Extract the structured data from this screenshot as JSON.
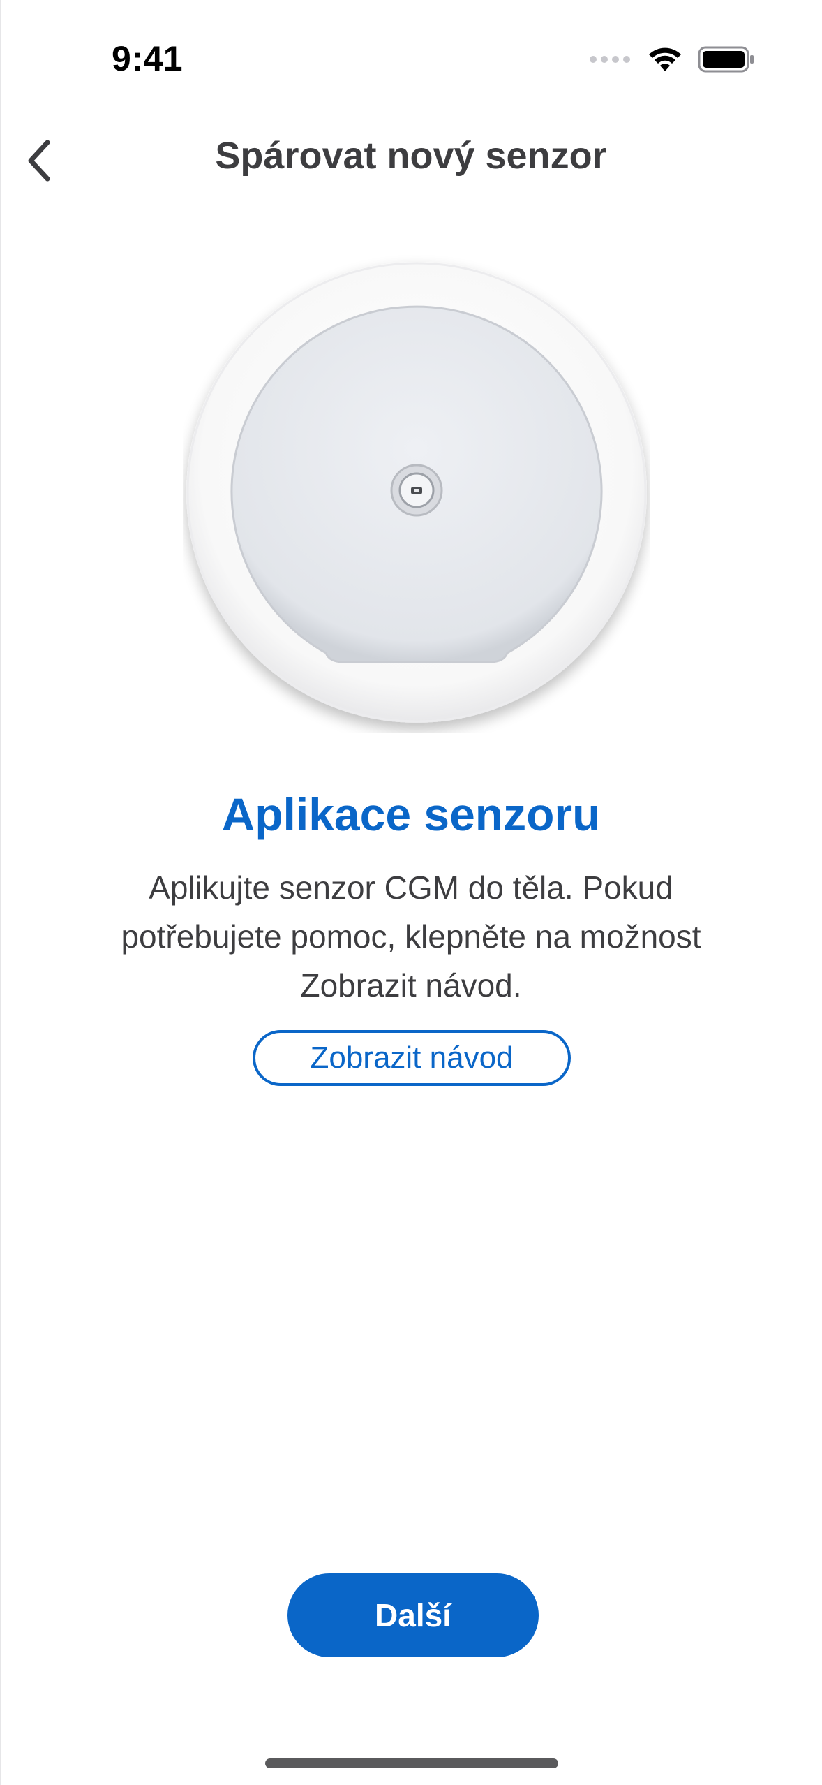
{
  "status_bar": {
    "time": "9:41"
  },
  "nav": {
    "title": "Spárovat nový senzor",
    "back_icon": "chevron-left-icon"
  },
  "content": {
    "image": "cgm-sensor-illustration",
    "title": "Aplikace senzoru",
    "description": "Aplikujte senzor CGM do těla. Pokud potřebujete pomoc, klepněte na možnost Zobrazit návod.",
    "guide_button_label": "Zobrazit návod"
  },
  "footer": {
    "next_button_label": "Další"
  },
  "colors": {
    "accent": "#0a66c8",
    "text": "#3d3d40",
    "background": "#ffffff"
  }
}
